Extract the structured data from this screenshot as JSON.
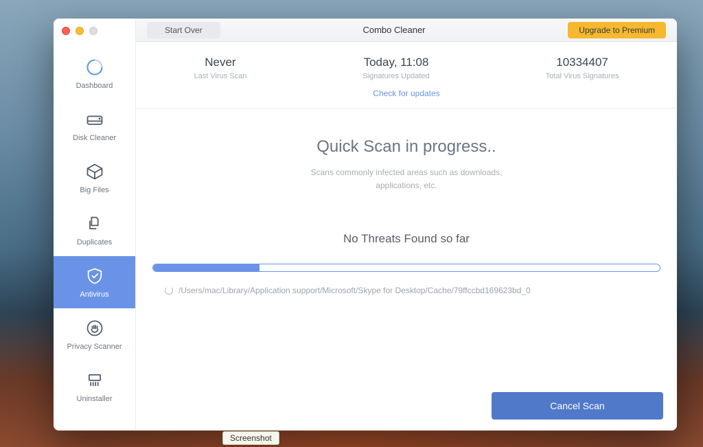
{
  "window": {
    "app_title": "Combo Cleaner",
    "start_over": "Start Over",
    "upgrade": "Upgrade to Premium"
  },
  "sidebar": {
    "items": [
      {
        "label": "Dashboard"
      },
      {
        "label": "Disk Cleaner"
      },
      {
        "label": "Big Files"
      },
      {
        "label": "Duplicates"
      },
      {
        "label": "Antivirus"
      },
      {
        "label": "Privacy Scanner"
      },
      {
        "label": "Uninstaller"
      }
    ]
  },
  "stats": {
    "last_scan": {
      "value": "Never",
      "desc": "Last Virus Scan"
    },
    "signatures_updated": {
      "value": "Today, 11:08",
      "desc": "Signatures Updated"
    },
    "total_signatures": {
      "value": "10334407",
      "desc": "Total Virus Signatures"
    },
    "check_updates": "Check for updates"
  },
  "scan": {
    "title": "Quick Scan in progress..",
    "subtitle": "Scans commonly infected areas such as downloads, applications, etc.",
    "threats": "No Threats Found so far",
    "progress_percent": 21,
    "current_path": "/Users/mac/Library/Application support/Microsoft/Skype for Desktop/Cache/79ffccbd169623bd_0"
  },
  "footer": {
    "cancel": "Cancel Scan"
  },
  "tooltip": "Screenshot"
}
